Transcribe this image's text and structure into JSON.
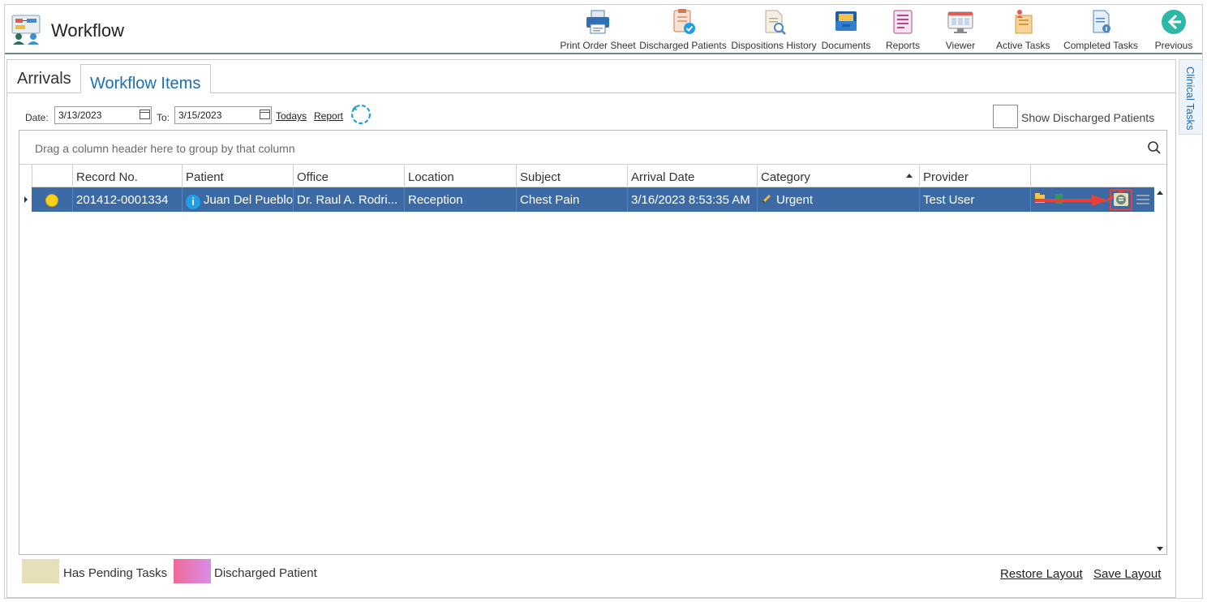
{
  "app": {
    "title": "Workflow"
  },
  "toolbar": [
    {
      "label": "Print Order Sheet",
      "icon": "printer-icon"
    },
    {
      "label": "Discharged Patients",
      "icon": "discharged-patients-icon"
    },
    {
      "label": "Dispositions History",
      "icon": "dispositions-history-icon"
    },
    {
      "label": "Documents",
      "icon": "documents-icon"
    },
    {
      "label": "Reports",
      "icon": "reports-icon"
    },
    {
      "label": "Viewer",
      "icon": "viewer-icon"
    },
    {
      "label": "Active Tasks",
      "icon": "active-tasks-icon"
    },
    {
      "label": "Completed Tasks",
      "icon": "completed-tasks-icon"
    },
    {
      "label": "Previous",
      "icon": "back-arrow-icon"
    }
  ],
  "tabs": {
    "arrivals": "Arrivals",
    "workflow_items": "Workflow Items"
  },
  "filter": {
    "date_label": "Date:",
    "date_from": "3/13/2023",
    "to_label": "To:",
    "date_to": "3/15/2023",
    "todays_link": "Todays",
    "report_link": "Report",
    "show_discharged_label": "Show Discharged Patients"
  },
  "grid": {
    "group_panel_text": "Drag a column header here to group by that column",
    "columns": [
      "Record No.",
      "Patient",
      "Office",
      "Location",
      "Subject",
      "Arrival Date",
      "Category",
      "Provider"
    ],
    "sorted_column": "Category",
    "rows": [
      {
        "status_color": "#f7d21c",
        "record_no": "201412-0001334",
        "patient": "Juan Del Pueblo",
        "office": "Dr. Raul A. Rodri...",
        "location": "Reception",
        "subject": "Chest Pain",
        "arrival_date": "3/16/2023 8:53:35 AM",
        "category": "Urgent",
        "provider": "Test User"
      }
    ]
  },
  "legend": {
    "pending_label": "Has Pending Tasks",
    "pending_color": "#e6e0b8",
    "discharged_label": "Discharged Patient",
    "discharged_colors": [
      "#f06a97",
      "#d98de8"
    ]
  },
  "footer": {
    "restore_layout": "Restore Layout",
    "save_layout": "Save Layout"
  },
  "side_panel": {
    "label": "Clinical Tasks"
  },
  "colors": {
    "selected_row": "#3b6aa5",
    "accent": "#1a6fb6",
    "annotation_arrow": "#e8413a"
  }
}
